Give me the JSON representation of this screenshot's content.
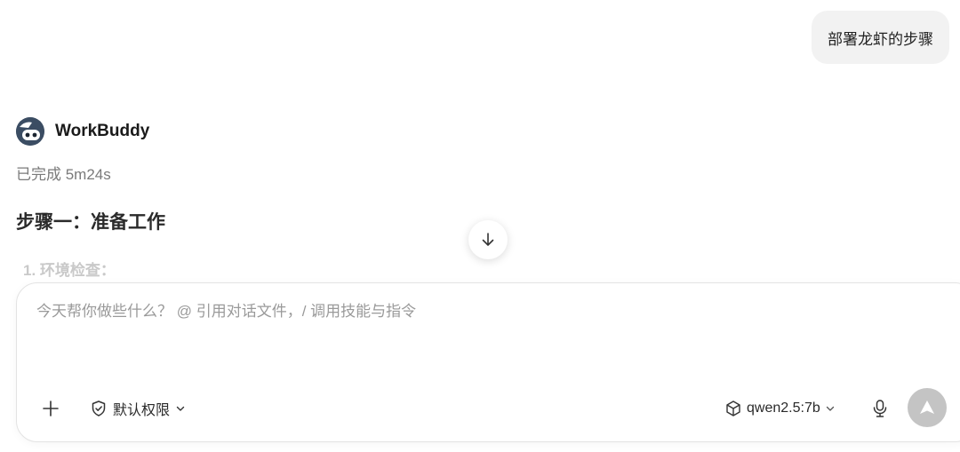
{
  "conversation": {
    "user_message": "部署龙虾的步骤",
    "assistant": {
      "name": "WorkBuddy",
      "status": "已完成 5m24s",
      "heading": "步骤一：准备工作",
      "faded_item": "1. 环境检查："
    }
  },
  "composer": {
    "placeholder": "今天帮你做些什么？ @ 引用对话文件，/ 调用技能与指令",
    "value": "",
    "permission_label": "默认权限",
    "model_label": "qwen2.5:7b"
  },
  "icons": {
    "avatar": "robot-avatar-icon",
    "scroll": "arrow-down-icon",
    "add": "plus-icon",
    "permission": "shield-check-icon",
    "model": "cube-icon",
    "mic": "microphone-icon",
    "send": "arrow-up-icon"
  },
  "colors": {
    "user_bubble": "#f2f2f2",
    "send_disabled": "#c4c4c4",
    "avatar": "#3b4d63"
  }
}
